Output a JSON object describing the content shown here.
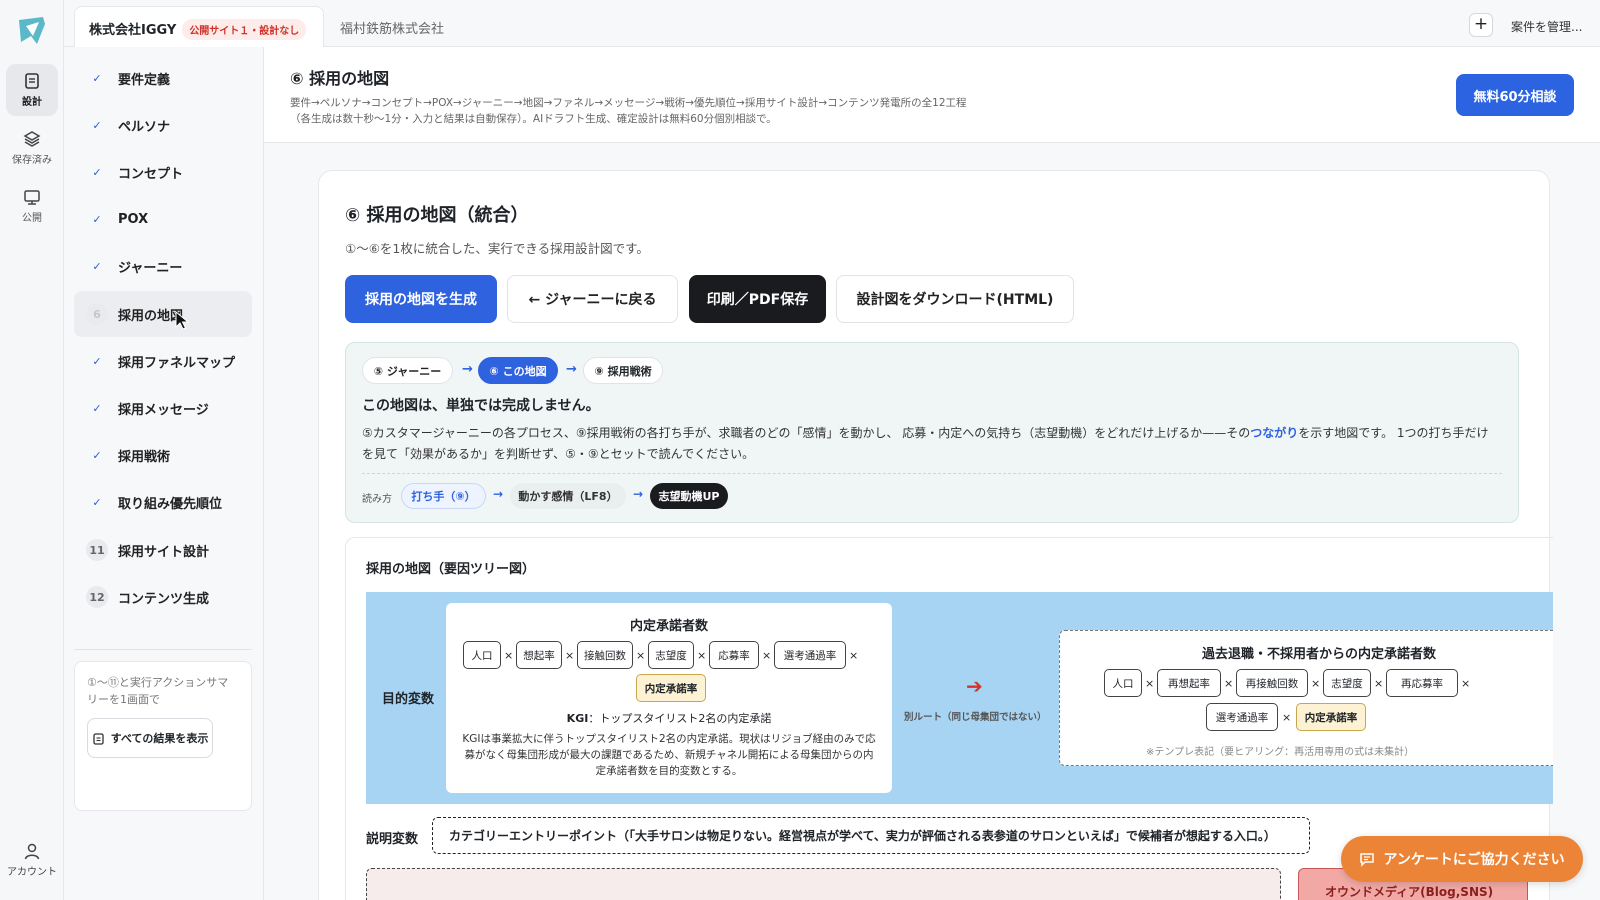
{
  "rail": {
    "design_label": "設計",
    "saved_label": "保存済み",
    "publish_label": "公開",
    "account_label": "アカウント"
  },
  "tabs": {
    "active_name": "株式会社IGGY",
    "active_badge": "公開サイト１・設計なし",
    "second_name": "福村鉄筋株式会社",
    "plus": "+",
    "manage": "案件を管理..."
  },
  "sidebar": {
    "steps": [
      {
        "mark": "✓",
        "label": "要件定義"
      },
      {
        "mark": "✓",
        "label": "ペルソナ"
      },
      {
        "mark": "✓",
        "label": "コンセプト"
      },
      {
        "mark": "✓",
        "label": "POX"
      },
      {
        "mark": "✓",
        "label": "ジャーニー"
      },
      {
        "mark": "6",
        "label": "採用の地図"
      },
      {
        "mark": "✓",
        "label": "採用ファネルマップ"
      },
      {
        "mark": "✓",
        "label": "採用メッセージ"
      },
      {
        "mark": "✓",
        "label": "採用戦術"
      },
      {
        "mark": "✓",
        "label": "取り組み優先順位"
      },
      {
        "mark": "11",
        "label": "採用サイト設計"
      },
      {
        "mark": "12",
        "label": "コンテンツ生成"
      }
    ],
    "summary_text": "①〜⑪と実行アクションサマリーを1画面で",
    "summary_button": "すべての結果を表示"
  },
  "header": {
    "title": "⑥ 採用の地図",
    "desc_line1": "要件→ペルソナ→コンセプト→POX→ジャーニー→地図→ファネル→メッセージ→戦術→優先順位→採用サイト設計→コンテンツ発電所の全12工程",
    "desc_line2": "（各生成は数十秒〜1分・入力と結果は自動保存）。AIドラフト生成、確定設計は無料60分個別相談で。",
    "cta": "無料60分相談"
  },
  "card": {
    "title": "⑥ 採用の地図（統合）",
    "subtitle": "①〜⑥を1枚に統合した、実行できる採用設計図です。",
    "buttons": {
      "generate": "採用の地図を生成",
      "back": "← ジャーニーに戻る",
      "print": "印刷／PDF保存",
      "download": "設計図をダウンロード(HTML)"
    }
  },
  "flow": {
    "pill_journey": "⑤ ジャーニー",
    "pill_map": "⑥ この地図",
    "pill_tactics": "⑨ 採用戦術",
    "arrow": "→",
    "heading": "この地図は、単独では完成しません。",
    "body_before": "⑤カスタマージャーニーの各プロセス、⑨採用戦術の各打ち手が、求職者のどの「感情」を動かし、 応募・内定への気持ち（志望動機）をどれだけ上げるか——その",
    "body_link": "つながり",
    "body_after": "を示す地図です。 1つの打ち手だけを見て「効果があるか」を判断せず、⑤・⑨とセットで読んでください。",
    "read_label": "読み方",
    "read_1": "打ち手（⑨）",
    "read_2": "動かす感情（LF8）",
    "read_3": "志望動機UP"
  },
  "tree": {
    "title": "採用の地図（要因ツリー図）",
    "band_label": "目的変数",
    "main_title": "内定承諾者数",
    "main_chips": [
      "人口",
      "想起率",
      "接触回数",
      "志望度",
      "応募率",
      "選考通過率"
    ],
    "main_last": "内定承諾率",
    "times": "×",
    "kgi_label": "KGI",
    "kgi_text": "：トップスタイリスト2名の内定承諾",
    "kgi_desc": "KGIは事業拡大に伴うトップスタイリスト2名の内定承諾。現状はリジョブ経由のみで応募がなく母集団形成が最大の課題であるため、新規チャネル開拓による母集団からの内定承諾者数を目的変数とする。",
    "arrow": "➔",
    "alt_label": "別ルート（同じ母集団ではない）",
    "alt_title": "過去退職・不採用者からの内定承諾者数",
    "alt_chips": [
      "人口",
      "再想起率",
      "再接触回数",
      "志望度",
      "再応募率"
    ],
    "alt_row2": [
      "選考通過率"
    ],
    "alt_last": "内定承諾率",
    "alt_note": "※テンプレ表記（要ヒアリング：再活用専用の式は未集計）",
    "ev_label": "説明変数",
    "ev_text": "カテゴリーエントリーポイント（「大手サロンは物足りない。経営視点が学べて、実力が評価される表参道のサロンといえば」で候補者が想起する入口。）",
    "bottom_right": "オウンドメディア(Blog,SNS)"
  },
  "fab": {
    "label": "アンケートにご協力ください"
  },
  "colors": {
    "accent": "#2f62df",
    "dark_button": "#1a1b1e",
    "fab": "#ec8437",
    "band": "#a8d4f3",
    "badge": "#d0332b"
  }
}
